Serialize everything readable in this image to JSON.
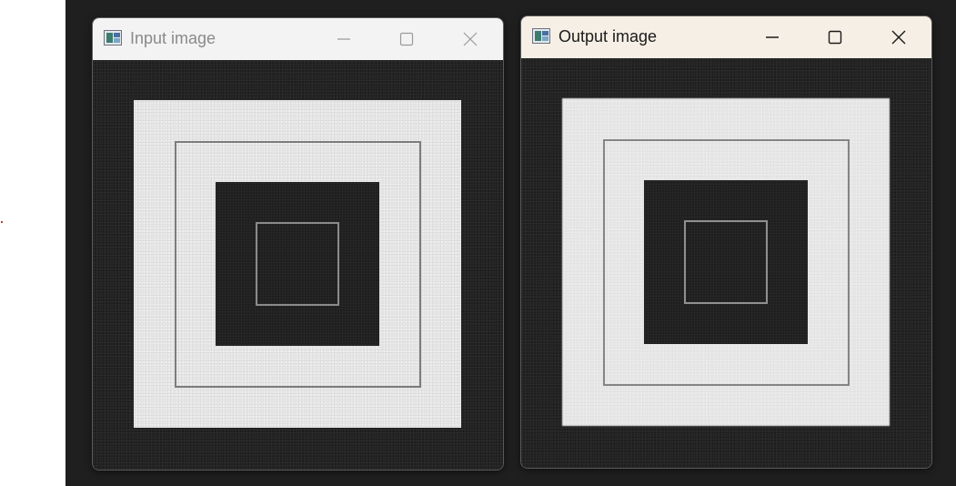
{
  "windows": [
    {
      "id": "input",
      "title": "Input image",
      "controls": {
        "minimize_icon": "minimize-icon",
        "maximize_icon": "maximize-icon",
        "close_icon": "close-icon"
      }
    },
    {
      "id": "output",
      "title": "Output image",
      "controls": {
        "minimize_icon": "minimize-icon",
        "maximize_icon": "maximize-icon",
        "close_icon": "close-icon"
      }
    }
  ],
  "colors": {
    "desktop_background": "#1f1f1f",
    "input_titlebar": "#f3f3f3",
    "output_titlebar": "#f6efe5",
    "image_dark": "#222222",
    "image_light": "#e7e7e7",
    "outline_gray": "#7c7c7c"
  },
  "image_content": {
    "description_icon": "concentric-squares-image"
  }
}
